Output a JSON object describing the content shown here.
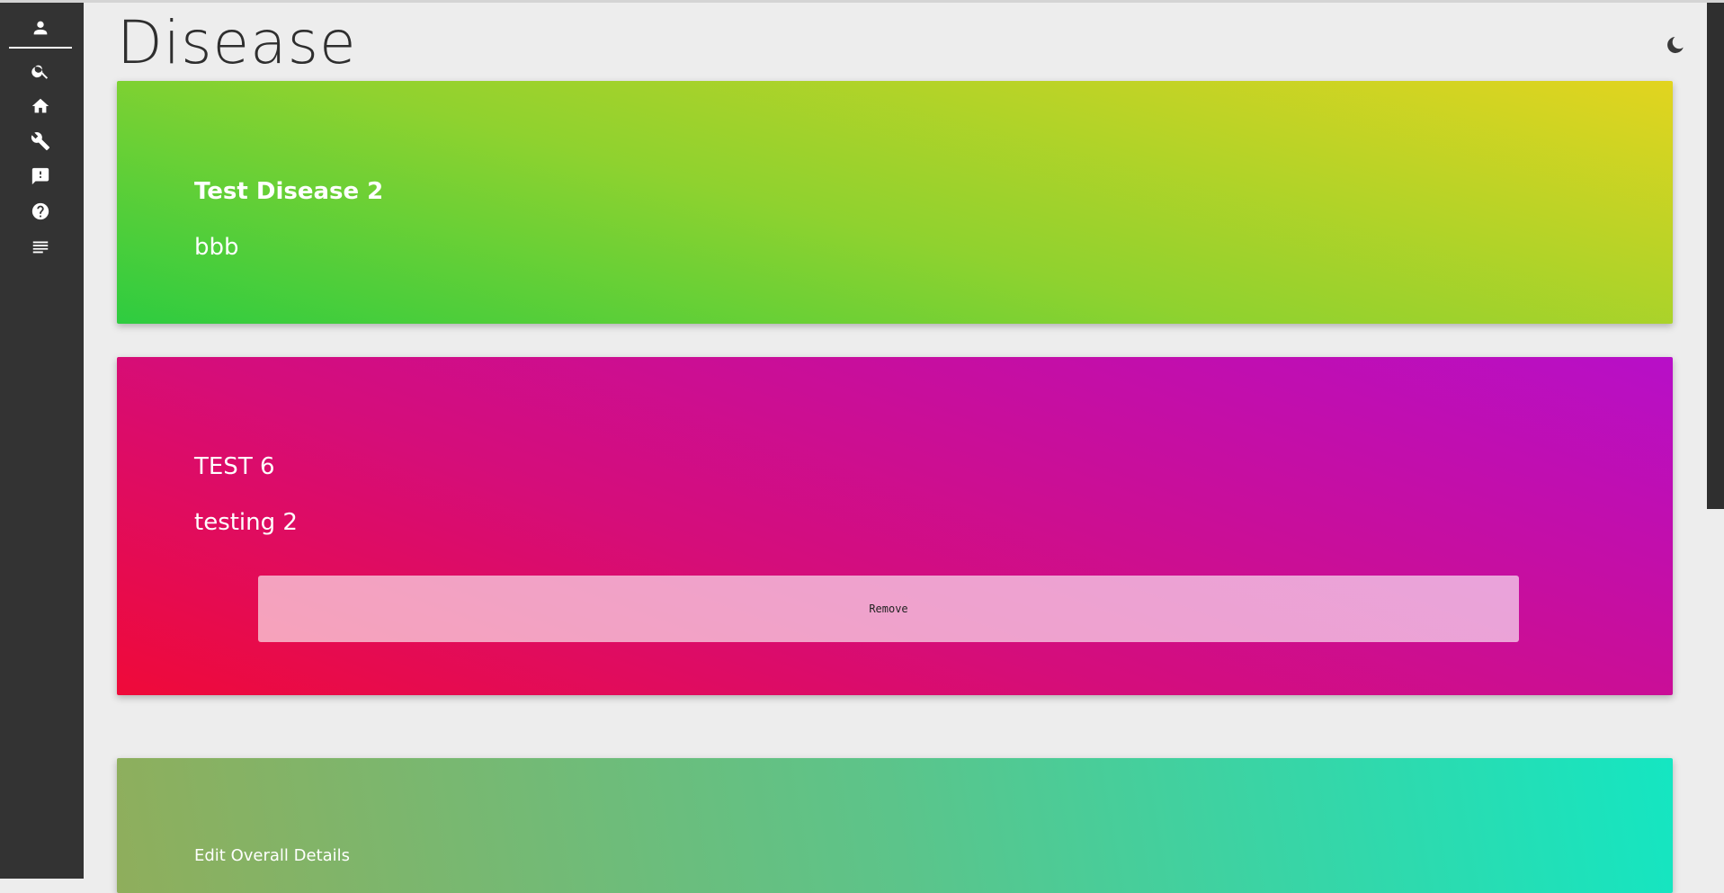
{
  "header": {
    "title": "Disease",
    "theme_toggle_icon": "moon-icon"
  },
  "sidebar": {
    "items": [
      {
        "icon": "user-icon",
        "active": true
      },
      {
        "icon": "search-icon"
      },
      {
        "icon": "home-icon"
      },
      {
        "icon": "wrench-icon"
      },
      {
        "icon": "feedback-icon"
      },
      {
        "icon": "help-icon"
      },
      {
        "icon": "list-icon"
      }
    ]
  },
  "diseases": [
    {
      "name": "Test Disease 2",
      "description": "bbb",
      "gradient": [
        "#2ecc40",
        "#e2d41f"
      ]
    },
    {
      "name": "TEST 6",
      "description": "testing 2",
      "gradient": [
        "#ef0a39",
        "#b70fc8"
      ],
      "remove_label": "Remove"
    }
  ],
  "overall": {
    "label": "Edit Overall Details",
    "gradient": [
      "#8fae5c",
      "#14e6c2"
    ]
  },
  "colors": {
    "sidebar_bg": "#333333",
    "page_bg": "#ededed",
    "title_text": "#2e2e2e"
  }
}
